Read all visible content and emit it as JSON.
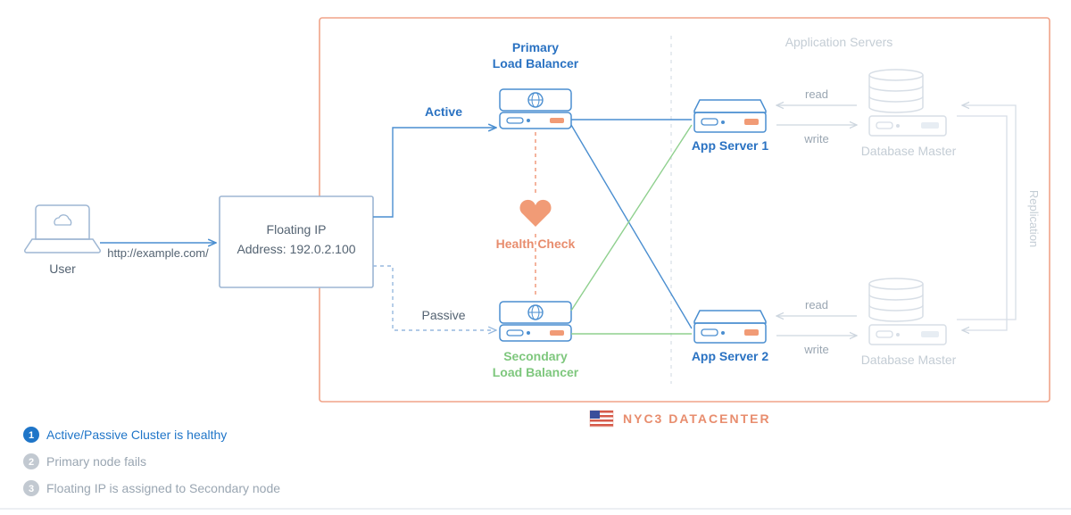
{
  "user": {
    "label": "User"
  },
  "url": "http://example.com/",
  "floating_ip": {
    "line1": "Floating IP",
    "line2": "Address: 192.0.2.100"
  },
  "lb": {
    "active": "Active",
    "passive": "Passive",
    "primary1": "Primary",
    "primary2": "Load Balancer",
    "secondary1": "Secondary",
    "secondary2": "Load Balancer",
    "health": "Health Check"
  },
  "app": {
    "title": "Application Servers",
    "s1": "App Server 1",
    "s2": "App Server 2",
    "read": "read",
    "write": "write"
  },
  "db": {
    "master1": "Database Master",
    "master2": "Database Master",
    "replication": "Replication"
  },
  "dc": "NYC3 DATACENTER",
  "steps": {
    "s1": "Active/Passive Cluster is healthy",
    "s2": "Primary node fails",
    "s3": "Floating IP is assigned to Secondary node"
  }
}
